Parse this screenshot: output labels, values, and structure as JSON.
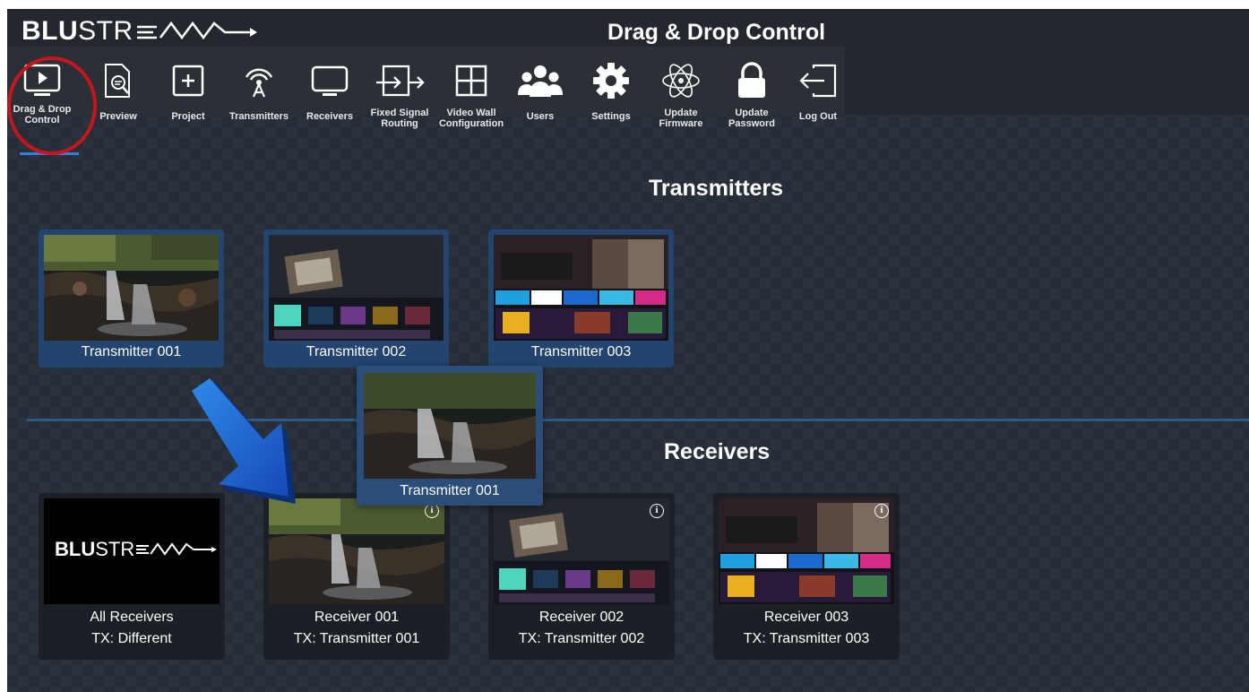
{
  "app": {
    "logo_bold": "BLU",
    "logo_light": "STREAM",
    "page_title": "Drag & Drop Control"
  },
  "nav": [
    {
      "label": "Drag & Drop\nControl",
      "icon": "play-screen-icon",
      "active": true
    },
    {
      "label": "Preview",
      "icon": "preview-document-icon"
    },
    {
      "label": "Project",
      "icon": "plus-box-icon"
    },
    {
      "label": "Transmitters",
      "icon": "antenna-icon"
    },
    {
      "label": "Receivers",
      "icon": "monitor-icon"
    },
    {
      "label": "Fixed Signal\nRouting",
      "icon": "routing-icon"
    },
    {
      "label": "Video Wall\nConfiguration",
      "icon": "grid-icon"
    },
    {
      "label": "Users",
      "icon": "users-icon"
    },
    {
      "label": "Settings",
      "icon": "gear-icon"
    },
    {
      "label": "Update\nFirmware",
      "icon": "atom-icon"
    },
    {
      "label": "Update\nPassword",
      "icon": "lock-icon"
    },
    {
      "label": "Log Out",
      "icon": "logout-icon"
    }
  ],
  "transmitters_title": "Transmitters",
  "receivers_title": "Receivers",
  "transmitters": [
    {
      "name": "Transmitter 001",
      "thumb": "waterfall"
    },
    {
      "name": "Transmitter 002",
      "thumb": "tv-home"
    },
    {
      "name": "Transmitter 003",
      "thumb": "streaming"
    }
  ],
  "drag_ghost": {
    "name": "Transmitter 001"
  },
  "receivers": [
    {
      "name": "All Receivers",
      "tx": "TX: Different",
      "thumb": "logo"
    },
    {
      "name": "Receiver 001",
      "tx": "TX: Transmitter 001",
      "thumb": "waterfall"
    },
    {
      "name": "Receiver 002",
      "tx": "TX: Transmitter 002",
      "thumb": "tv-home"
    },
    {
      "name": "Receiver 003",
      "tx": "TX: Transmitter 003",
      "thumb": "streaming"
    }
  ],
  "all_receivers_logo": {
    "bold": "BLU",
    "light": "STREAM"
  },
  "colors": {
    "accent_blue": "#3a7bd5",
    "highlight_red": "#c4161c",
    "card_blue": "#22446e"
  }
}
